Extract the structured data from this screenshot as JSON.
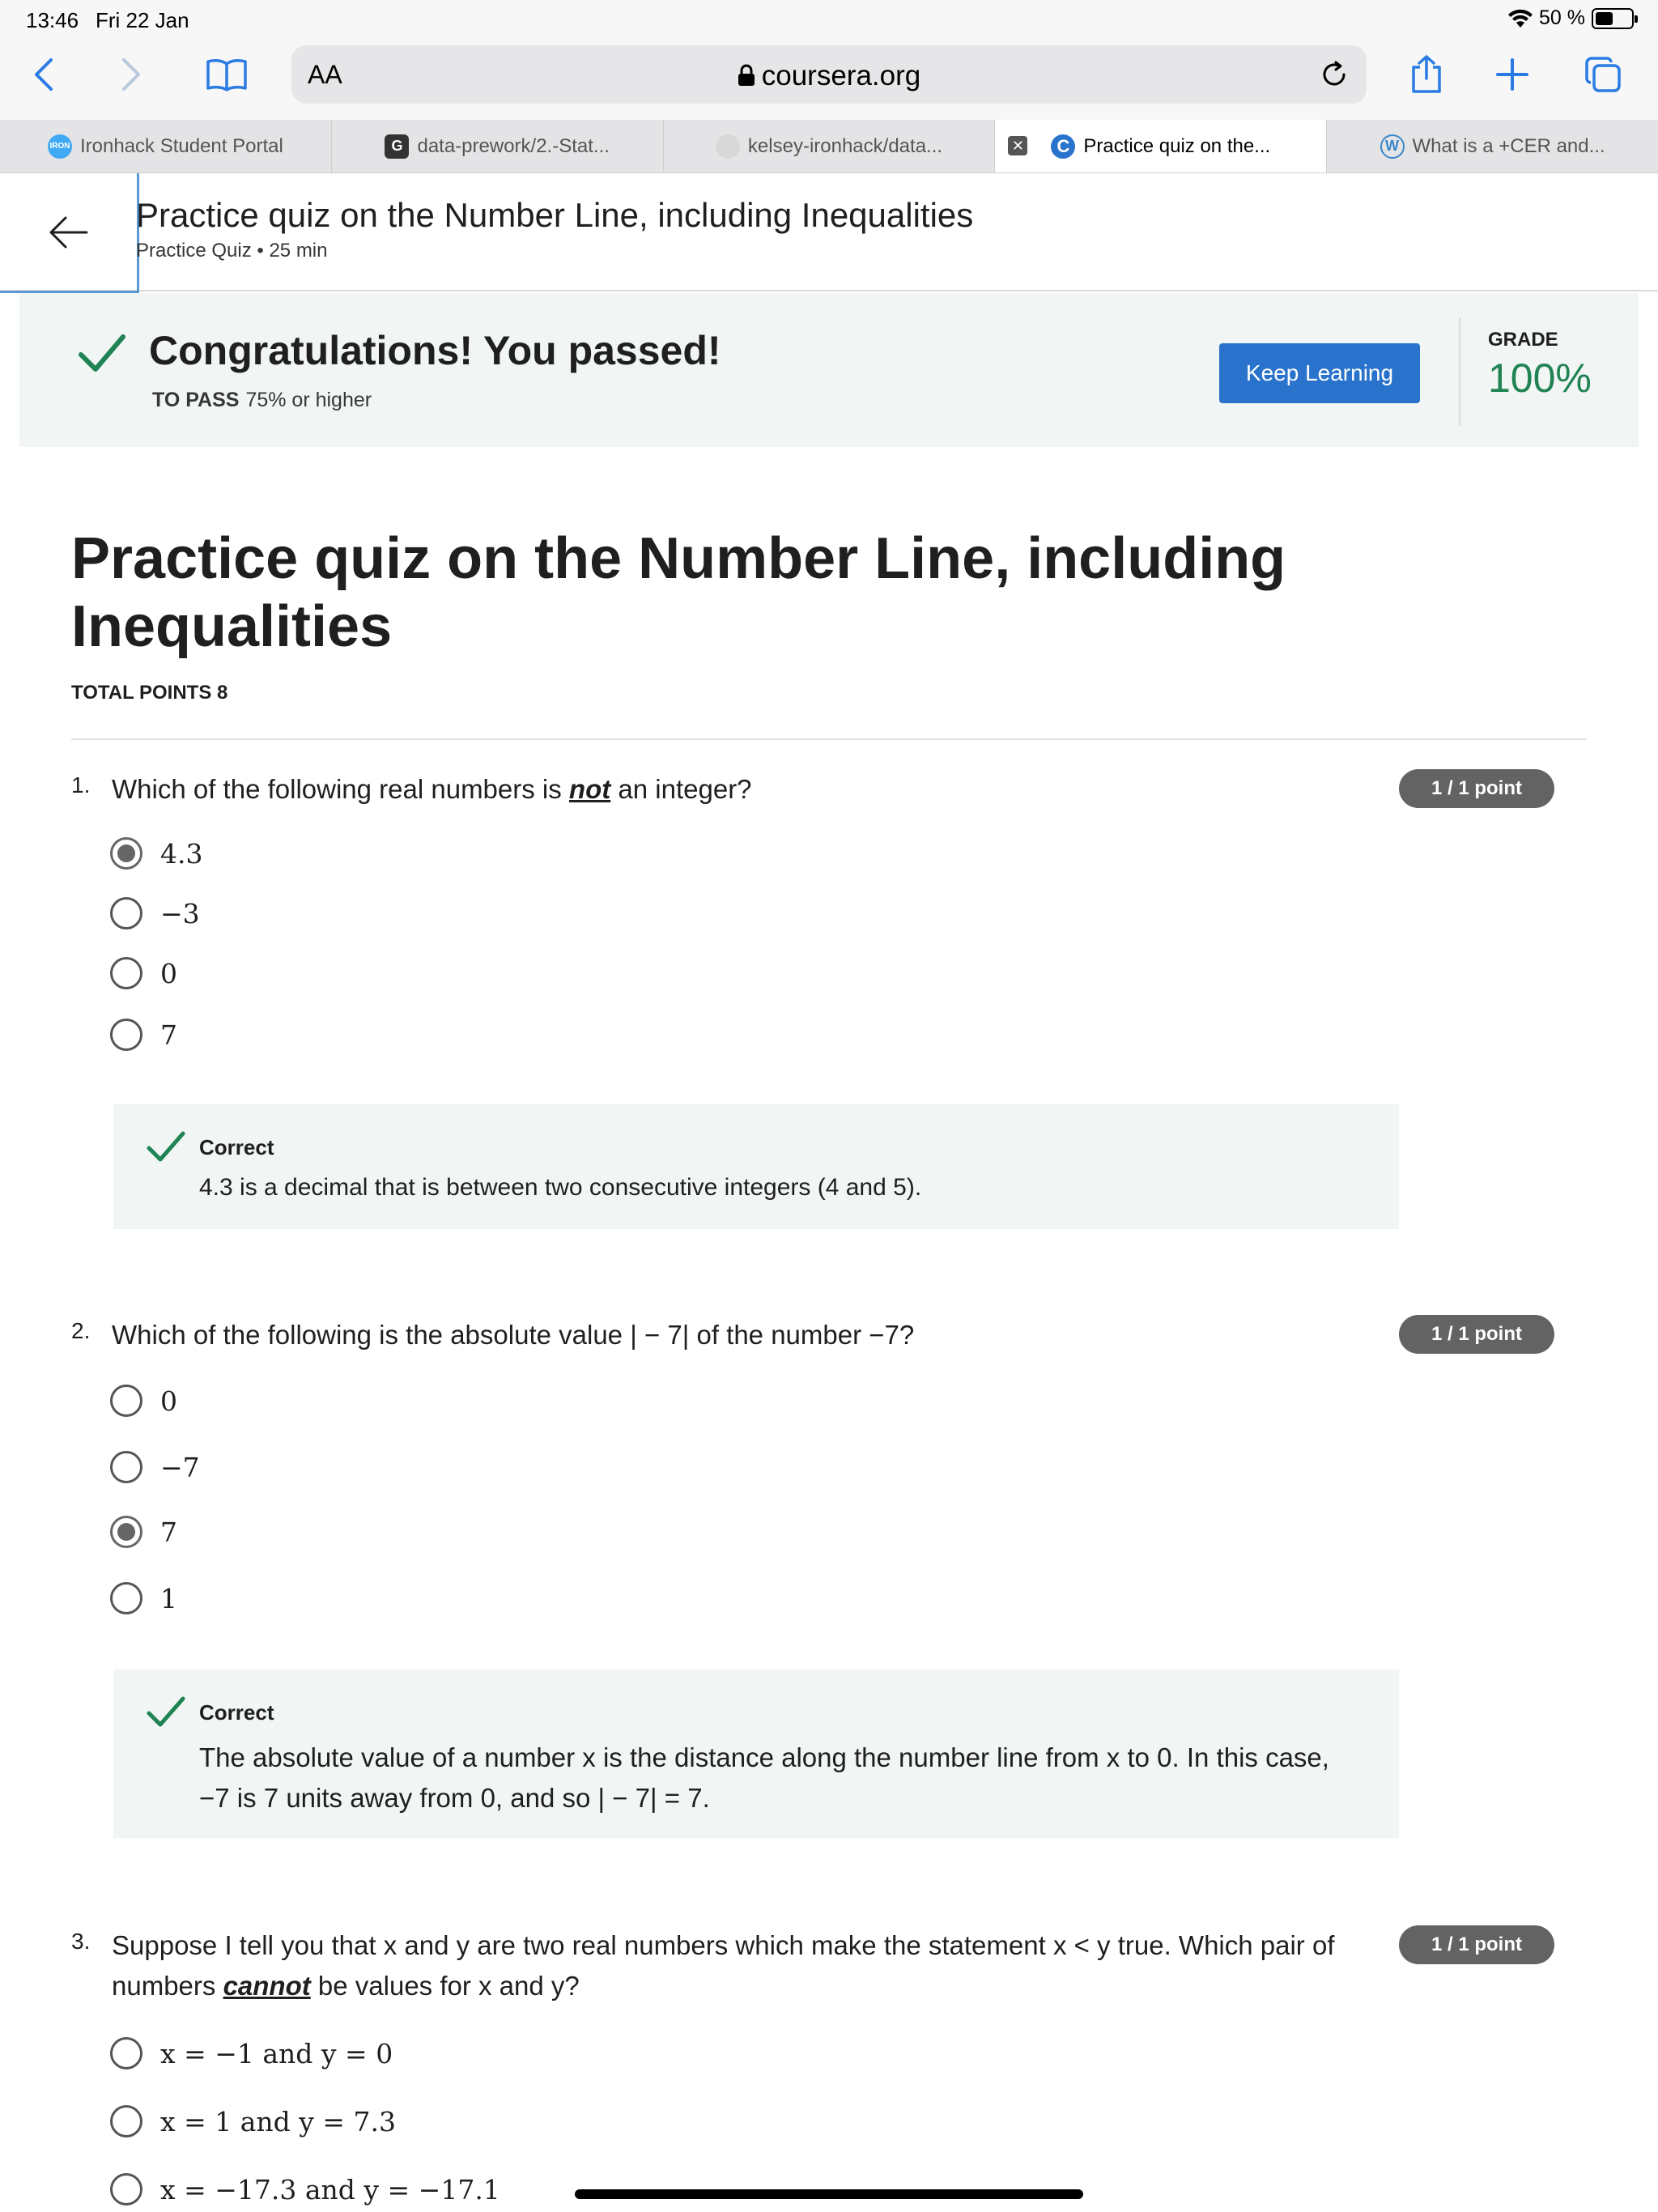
{
  "status": {
    "time": "13:46",
    "date": "Fri 22 Jan",
    "battery": "50 %",
    "battery_level": 0.5
  },
  "toolbar": {
    "aa": "AA",
    "url": "coursera.org"
  },
  "tabs": [
    {
      "label": "Ironhack Student Portal",
      "favicon": "ironhack-icon",
      "active": false
    },
    {
      "label": "data-prework/2.-Stat...",
      "favicon": "google-g-icon",
      "active": false
    },
    {
      "label": "kelsey-ironhack/data...",
      "favicon": "github-icon",
      "active": false
    },
    {
      "label": "Practice quiz on the...",
      "favicon": "coursera-icon",
      "active": true
    },
    {
      "label": "What is a +CER and...",
      "favicon": "wordpress-icon",
      "active": false
    }
  ],
  "header": {
    "title": "Practice quiz on the Number Line, including Inequalities",
    "subtitle": "Practice Quiz • 25 min"
  },
  "banner": {
    "title": "Congratulations! You passed!",
    "to_pass_label": "TO PASS",
    "to_pass_value": "75% or higher",
    "button": "Keep Learning",
    "grade_label": "GRADE",
    "grade_value": "100%"
  },
  "quiz": {
    "title": "Practice quiz on the Number Line, including Inequalities",
    "total_points": "TOTAL POINTS 8"
  },
  "questions": [
    {
      "number": "1.",
      "text_before": "Which of the following real numbers is ",
      "text_emph": "not",
      "text_after": " an integer?",
      "points": "1 / 1 point",
      "options": [
        "4.3",
        "−3",
        "0",
        "7"
      ],
      "selected": 0,
      "feedback_title": "Correct",
      "feedback": "4.3 is a decimal that is between two consecutive integers (4 and 5)."
    },
    {
      "number": "2.",
      "text": "Which of the following is the absolute value | − 7| of the number −7?",
      "points": "1 / 1 point",
      "options": [
        "0",
        "−7",
        "7",
        "1"
      ],
      "selected": 2,
      "feedback_title": "Correct",
      "feedback_line1": "The absolute value of a number x is the distance along the number line from x to 0. In this case,",
      "feedback_line2": "−7 is 7 units away from 0, and so | − 7| = 7."
    },
    {
      "number": "3.",
      "text_line1": "Suppose I tell you that x and y are two real numbers which make the statement x  < y true. Which pair of",
      "text_before": "numbers ",
      "text_emph": "cannot",
      "text_after": " be values for x and y?",
      "points": "1 / 1 point",
      "options": [
        "x = −1 and y = 0",
        "x = 1 and y =  7.3",
        "x =  −17.3 and y = −17.1"
      ]
    }
  ]
}
